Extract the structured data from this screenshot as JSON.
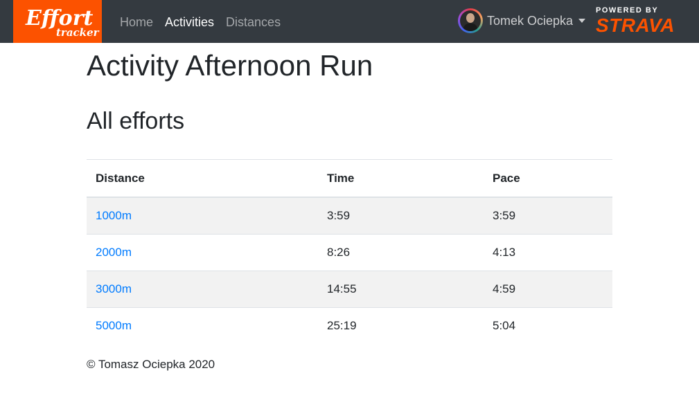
{
  "brand": {
    "logo_text_main": "Effort",
    "logo_text_sub": "tracker",
    "logo_color": "#fc5200"
  },
  "nav": {
    "items": [
      {
        "label": "Home",
        "active": false
      },
      {
        "label": "Activities",
        "active": true
      },
      {
        "label": "Distances",
        "active": false
      }
    ]
  },
  "user": {
    "name": "Tomek Ociepka"
  },
  "strava": {
    "powered_by": "POWERED BY",
    "name": "STRAVA",
    "color": "#fc5200"
  },
  "page": {
    "title": "Activity Afternoon Run",
    "section_title": "All efforts"
  },
  "table": {
    "headers": [
      "Distance",
      "Time",
      "Pace"
    ],
    "rows": [
      {
        "distance": "1000m",
        "time": "3:59",
        "pace": "3:59"
      },
      {
        "distance": "2000m",
        "time": "8:26",
        "pace": "4:13"
      },
      {
        "distance": "3000m",
        "time": "14:55",
        "pace": "4:59"
      },
      {
        "distance": "5000m",
        "time": "25:19",
        "pace": "5:04"
      }
    ]
  },
  "footer": {
    "text": "© Tomasz Ociepka 2020"
  }
}
